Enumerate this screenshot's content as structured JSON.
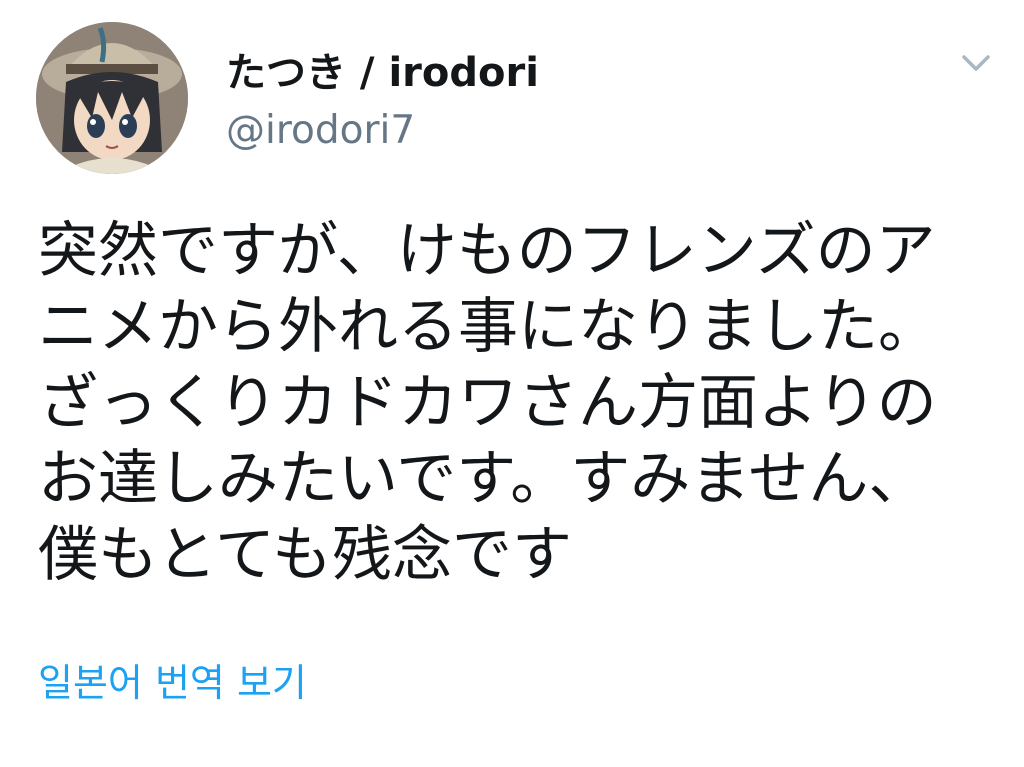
{
  "author": {
    "display_name": "たつき / irodori",
    "handle": "@irodori7",
    "avatar_icon": "profile-avatar-icon"
  },
  "tweet": {
    "text": "突然ですが、けものフレンズのアニメから外れる事になりました。ざっくりカドカワさん方面よりのお達しみたいです。すみません、僕もとても残念です"
  },
  "actions": {
    "translate_label": "일본어 번역 보기",
    "menu_icon": "chevron-down-icon"
  },
  "colors": {
    "link": "#1da1f2",
    "handle": "#657786",
    "text": "#14171a",
    "caret": "#aab8c2"
  }
}
